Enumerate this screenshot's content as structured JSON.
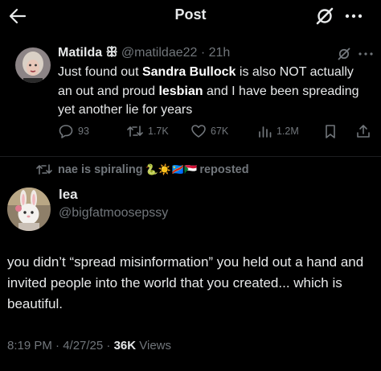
{
  "header": {
    "title": "Post",
    "back_icon": "back-arrow-icon",
    "grok_icon": "grok-icon",
    "more_icon": "more-icon"
  },
  "quoted_post": {
    "author_name": "Matilda",
    "author_badge": "ꕥ",
    "author_handle": "@matildae22",
    "separator": " · ",
    "time": "21h",
    "text_parts": [
      "Just found out ",
      "Sandra Bullock",
      " is also NOT actually an out and proud ",
      "lesbian",
      " and I have been spreading yet another lie for years"
    ],
    "stats": {
      "replies": "93",
      "reposts": "1.7K",
      "likes": "67K",
      "views": "1.2M"
    }
  },
  "repost_banner": {
    "text": "nae is spiraling",
    "emojis": "🐍☀️🇨🇩🇸🇩",
    "suffix": "reposted"
  },
  "main_post": {
    "author_name": "lea",
    "author_handle": "@bigfatmoosepssy",
    "text": "you didn’t “spread misinformation” you held out a hand and invited people into the world that you created... which is beautiful.",
    "timestamp": "8:19 PM · 4/27/25 · ",
    "views_count": "36K",
    "views_label": " Views"
  },
  "colors": {
    "background": "#000000",
    "text": "#e7e9ea",
    "muted": "#71767b"
  }
}
